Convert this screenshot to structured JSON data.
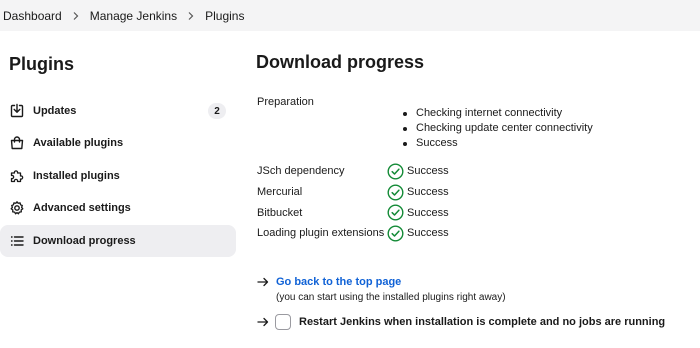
{
  "breadcrumb": [
    "Dashboard",
    "Manage Jenkins",
    "Plugins"
  ],
  "sidebar": {
    "title": "Plugins",
    "items": [
      {
        "label": "Updates",
        "icon": "download-icon",
        "badge": "2"
      },
      {
        "label": "Available plugins",
        "icon": "shopping-bag-icon"
      },
      {
        "label": "Installed plugins",
        "icon": "puzzle-piece-icon"
      },
      {
        "label": "Advanced settings",
        "icon": "gear-icon"
      },
      {
        "label": "Download progress",
        "icon": "list-icon",
        "active": true
      }
    ]
  },
  "main": {
    "title": "Download progress",
    "preparation": {
      "label": "Preparation",
      "steps": [
        "Checking internet connectivity",
        "Checking update center connectivity",
        "Success"
      ]
    },
    "statuses": [
      {
        "name": "JSch dependency",
        "status": "Success"
      },
      {
        "name": "Mercurial",
        "status": "Success"
      },
      {
        "name": "Bitbucket",
        "status": "Success"
      },
      {
        "name": "Loading plugin extensions",
        "status": "Success"
      }
    ],
    "back_link": "Go back to the top page",
    "back_note": "(you can start using the installed plugins right away)",
    "restart_label": "Restart Jenkins when installation is complete and no jobs are running",
    "restart_checked": false
  },
  "colors": {
    "link": "#1062d6",
    "success": "#138a36",
    "active_bg": "#eeeef1",
    "topbar_bg": "#f4f4f5"
  }
}
